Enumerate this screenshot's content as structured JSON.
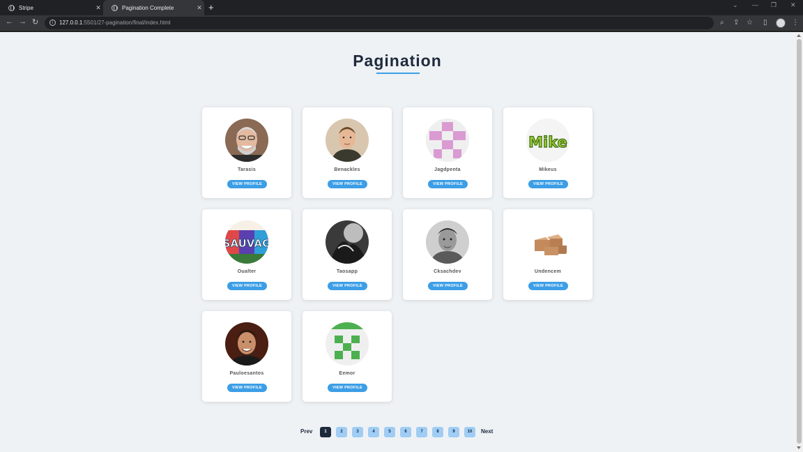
{
  "browser": {
    "tabs": [
      {
        "title": "Stripe"
      },
      {
        "title": "Pagination Complete"
      }
    ],
    "url_host": "127.0.0.1",
    "url_path": ":5501/27-pagination/final/index.html"
  },
  "page": {
    "title": "Pagination"
  },
  "users": [
    {
      "name": "Tarasis",
      "button": "VIEW PROFILE"
    },
    {
      "name": "Benackles",
      "button": "VIEW PROFILE"
    },
    {
      "name": "Jagdpenta",
      "button": "VIEW PROFILE"
    },
    {
      "name": "Mikeus",
      "button": "VIEW PROFILE"
    },
    {
      "name": "Oualter",
      "button": "VIEW PROFILE"
    },
    {
      "name": "Taosapp",
      "button": "VIEW PROFILE"
    },
    {
      "name": "Cksachdev",
      "button": "VIEW PROFILE"
    },
    {
      "name": "Undencem",
      "button": "VIEW PROFILE"
    },
    {
      "name": "Pauloesantos",
      "button": "VIEW PROFILE"
    },
    {
      "name": "Eemor",
      "button": "VIEW PROFILE"
    }
  ],
  "avatar_texts": {
    "mikeus": "Mike",
    "oualter": "SAUVAG"
  },
  "pagination": {
    "prev": "Prev",
    "next": "Next",
    "pages": [
      "1",
      "2",
      "3",
      "4",
      "5",
      "6",
      "7",
      "8",
      "9",
      "10"
    ],
    "current": "1"
  },
  "colors": {
    "accent": "#3c9ee6",
    "dark": "#1e2a3c",
    "page_btn": "#9fcdf4"
  }
}
